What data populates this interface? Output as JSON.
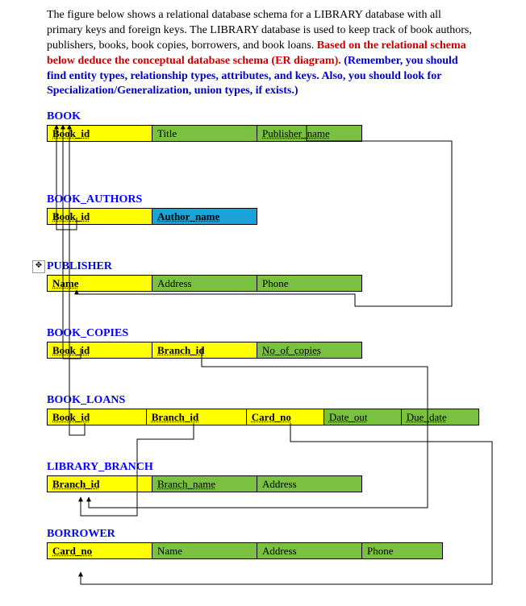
{
  "intro": {
    "black": "The figure below shows a relational database schema for a LIBRARY database with all primary keys and foreign keys. The LIBRARY database is used to keep track of book authors, publishers, books, book copies, borrowers, and book loans. ",
    "red": "Based on the relational schema below deduce the conceptual database schema (ER diagram). ",
    "blue": "(Remember, you should find entity types, relationship types, attributes, and keys. Also, you should look for Specialization/Generalization, union types, if exists.)"
  },
  "tables": {
    "book": {
      "title": "BOOK",
      "cols": [
        "Book_id",
        "Title",
        "Publisher_name"
      ]
    },
    "book_authors": {
      "title": "BOOK_AUTHORS",
      "cols": [
        "Book_id",
        "Author_name"
      ]
    },
    "publisher": {
      "title": "PUBLISHER",
      "cols": [
        "Name",
        "Address",
        "Phone"
      ]
    },
    "book_copies": {
      "title": "BOOK_COPIES",
      "cols": [
        "Book_id",
        "Branch_id",
        "No_of_copies"
      ]
    },
    "book_loans": {
      "title": "BOOK_LOANS",
      "cols": [
        "Book_id",
        "Branch_id",
        "Card_no",
        "Date_out",
        "Due_date"
      ]
    },
    "library_branch": {
      "title": "LIBRARY_BRANCH",
      "cols": [
        "Branch_id",
        "Branch_name",
        "Address"
      ]
    },
    "borrower": {
      "title": "BORROWER",
      "cols": [
        "Card_no",
        "Name",
        "Address",
        "Phone"
      ]
    }
  },
  "move_handle": "✥"
}
